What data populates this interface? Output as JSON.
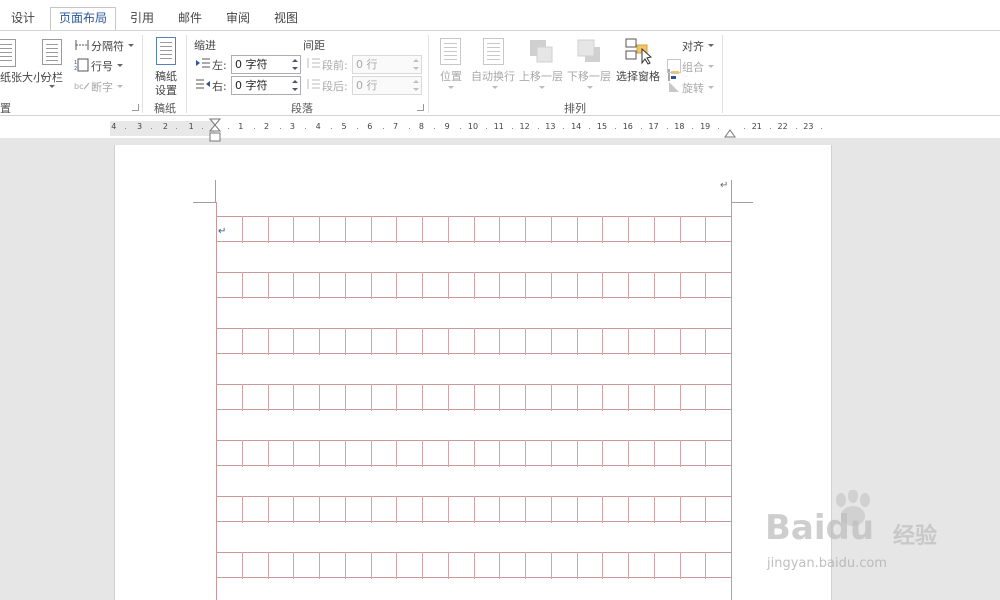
{
  "tabs": [
    "设计",
    "页面布局",
    "引用",
    "邮件",
    "审阅",
    "视图"
  ],
  "active_tab": "页面布局",
  "ribbon": {
    "page_setup": {
      "paper_size": "纸张大小",
      "columns": "分栏",
      "breaks": "分隔符",
      "line_numbers": "行号",
      "hyphenation": "断字",
      "group_label": "置"
    },
    "draft_paper": {
      "button_line1": "稿纸",
      "button_line2": "设置",
      "group_label": "稿纸"
    },
    "paragraph": {
      "indent_label": "缩进",
      "spacing_label": "间距",
      "left_label": "左:",
      "right_label": "右:",
      "left_value": "0 字符",
      "right_value": "0 字符",
      "before_label": "段前:",
      "after_label": "段后:",
      "before_value": "0 行",
      "after_value": "0 行",
      "group_label": "段落"
    },
    "arrange": {
      "position": "位置",
      "wrap_text": "自动换行",
      "bring_forward": "上移一层",
      "send_backward": "下移一层",
      "selection_pane": "选择窗格",
      "align": "对齐",
      "group": "组合",
      "rotate": "旋转",
      "group_label": "排列"
    }
  },
  "ruler": {
    "left_numbers": [
      "4",
      "3",
      "2",
      "1"
    ],
    "right_numbers": [
      "1",
      "2",
      "3",
      "4",
      "5",
      "6",
      "7",
      "8",
      "9",
      "10",
      "11",
      "12",
      "13",
      "14",
      "15",
      "16",
      "17",
      "18",
      "19",
      "",
      "21",
      "22",
      "23"
    ]
  },
  "document": {
    "paragraph_mark": "↵"
  },
  "watermark": {
    "brand": "Baidu",
    "cn": "经验",
    "url": "jingyan.baidu.com"
  },
  "colors": {
    "accent": "#2b579a",
    "grid_line": "#c89999"
  }
}
